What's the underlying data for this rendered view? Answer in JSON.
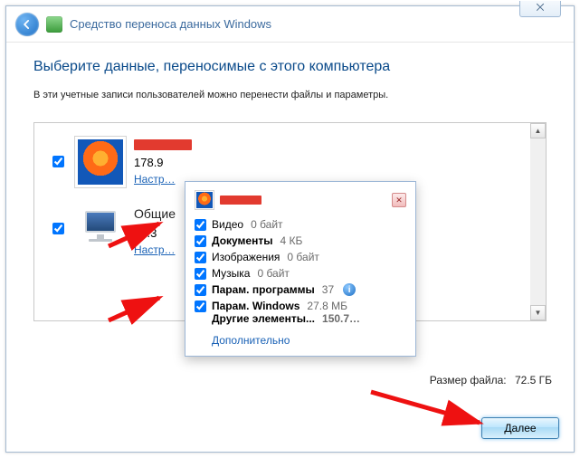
{
  "header": {
    "title": "Средство переноса данных Windows"
  },
  "page": {
    "title": "Выберите данные, переносимые с этого компьютера",
    "subtitle": "В эти учетные записи пользователей можно перенести файлы и параметры."
  },
  "items": [
    {
      "kind": "user",
      "size": "178.9",
      "customize": "Настр…"
    },
    {
      "kind": "shared",
      "name": "Общие",
      "size": "72.3",
      "customize": "Настр…"
    }
  ],
  "popup": {
    "rows": [
      {
        "label": "Видео",
        "value": "0 байт",
        "checked": true,
        "bold": false
      },
      {
        "label": "Документы",
        "value": "4 КБ",
        "checked": true,
        "bold": true
      },
      {
        "label": "Изображения",
        "value": "0 байт",
        "checked": true,
        "bold": false
      },
      {
        "label": "Музыка",
        "value": "0 байт",
        "checked": true,
        "bold": false
      },
      {
        "label": "Парам. программы",
        "value": "37",
        "checked": true,
        "bold": true,
        "info": true
      },
      {
        "label": "Парам. Windows",
        "value": "27.8 МБ",
        "checked": true,
        "bold": true
      }
    ],
    "other": {
      "label": "Другие элементы...",
      "value": "150.7…"
    },
    "advanced": "Дополнительно"
  },
  "footer": {
    "fsize_label": "Размер файла:",
    "fsize_value": "72.5 ГБ",
    "next": "Далее"
  },
  "close_glyph": "⨉"
}
